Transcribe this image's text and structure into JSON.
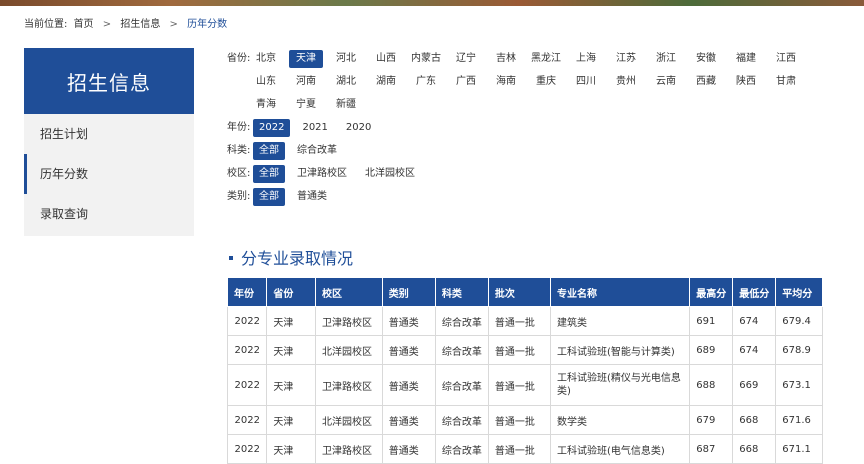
{
  "breadcrumb": {
    "label": "当前位置:",
    "items": [
      "首页",
      "招生信息",
      "历年分数"
    ],
    "separator": ">"
  },
  "sidebar": {
    "title": "招生信息",
    "items": [
      {
        "label": "招生计划"
      },
      {
        "label": "历年分数",
        "active": true
      },
      {
        "label": "录取查询"
      }
    ]
  },
  "filters": {
    "province": {
      "label": "省份:",
      "options": [
        "北京",
        "天津",
        "河北",
        "山西",
        "内蒙古",
        "辽宁",
        "吉林",
        "黑龙江",
        "上海",
        "江苏",
        "浙江",
        "安徽",
        "福建",
        "江西",
        "山东",
        "河南",
        "湖北",
        "湖南",
        "广东",
        "广西",
        "海南",
        "重庆",
        "四川",
        "贵州",
        "云南",
        "西藏",
        "陕西",
        "甘肃",
        "青海",
        "宁夏",
        "新疆"
      ],
      "selected": "天津"
    },
    "year": {
      "label": "年份:",
      "options": [
        "2022",
        "2021",
        "2020"
      ],
      "selected": "2022"
    },
    "subject": {
      "label": "科类:",
      "options": [
        "全部",
        "综合改革"
      ],
      "selected": "全部"
    },
    "campus": {
      "label": "校区:",
      "options": [
        "全部",
        "卫津路校区",
        "北洋园校区"
      ],
      "selected": "全部"
    },
    "category": {
      "label": "类别:",
      "options": [
        "全部",
        "普通类"
      ],
      "selected": "全部"
    }
  },
  "section": {
    "title": "分专业录取情况"
  },
  "table": {
    "headers": [
      "年份",
      "省份",
      "校区",
      "类别",
      "科类",
      "批次",
      "专业名称",
      "最高分",
      "最低分",
      "平均分"
    ],
    "rows": [
      [
        "2022",
        "天津",
        "卫津路校区",
        "普通类",
        "综合改革",
        "普通一批",
        "建筑类",
        "691",
        "674",
        "679.4"
      ],
      [
        "2022",
        "天津",
        "北洋园校区",
        "普通类",
        "综合改革",
        "普通一批",
        "工科试验班(智能与计算类)",
        "689",
        "674",
        "678.9"
      ],
      [
        "2022",
        "天津",
        "卫津路校区",
        "普通类",
        "综合改革",
        "普通一批",
        "工科试验班(精仪与光电信息类)",
        "688",
        "669",
        "673.1"
      ],
      [
        "2022",
        "天津",
        "北洋园校区",
        "普通类",
        "综合改革",
        "普通一批",
        "数学类",
        "679",
        "668",
        "671.6"
      ],
      [
        "2022",
        "天津",
        "卫津路校区",
        "普通类",
        "综合改革",
        "普通一批",
        "工科试验班(电气信息类)",
        "687",
        "668",
        "671.1"
      ]
    ]
  },
  "colors": {
    "accent": "#1f4e98",
    "sidebar_bg": "#f2f2f2",
    "cell_border": "#d9d9d9"
  }
}
